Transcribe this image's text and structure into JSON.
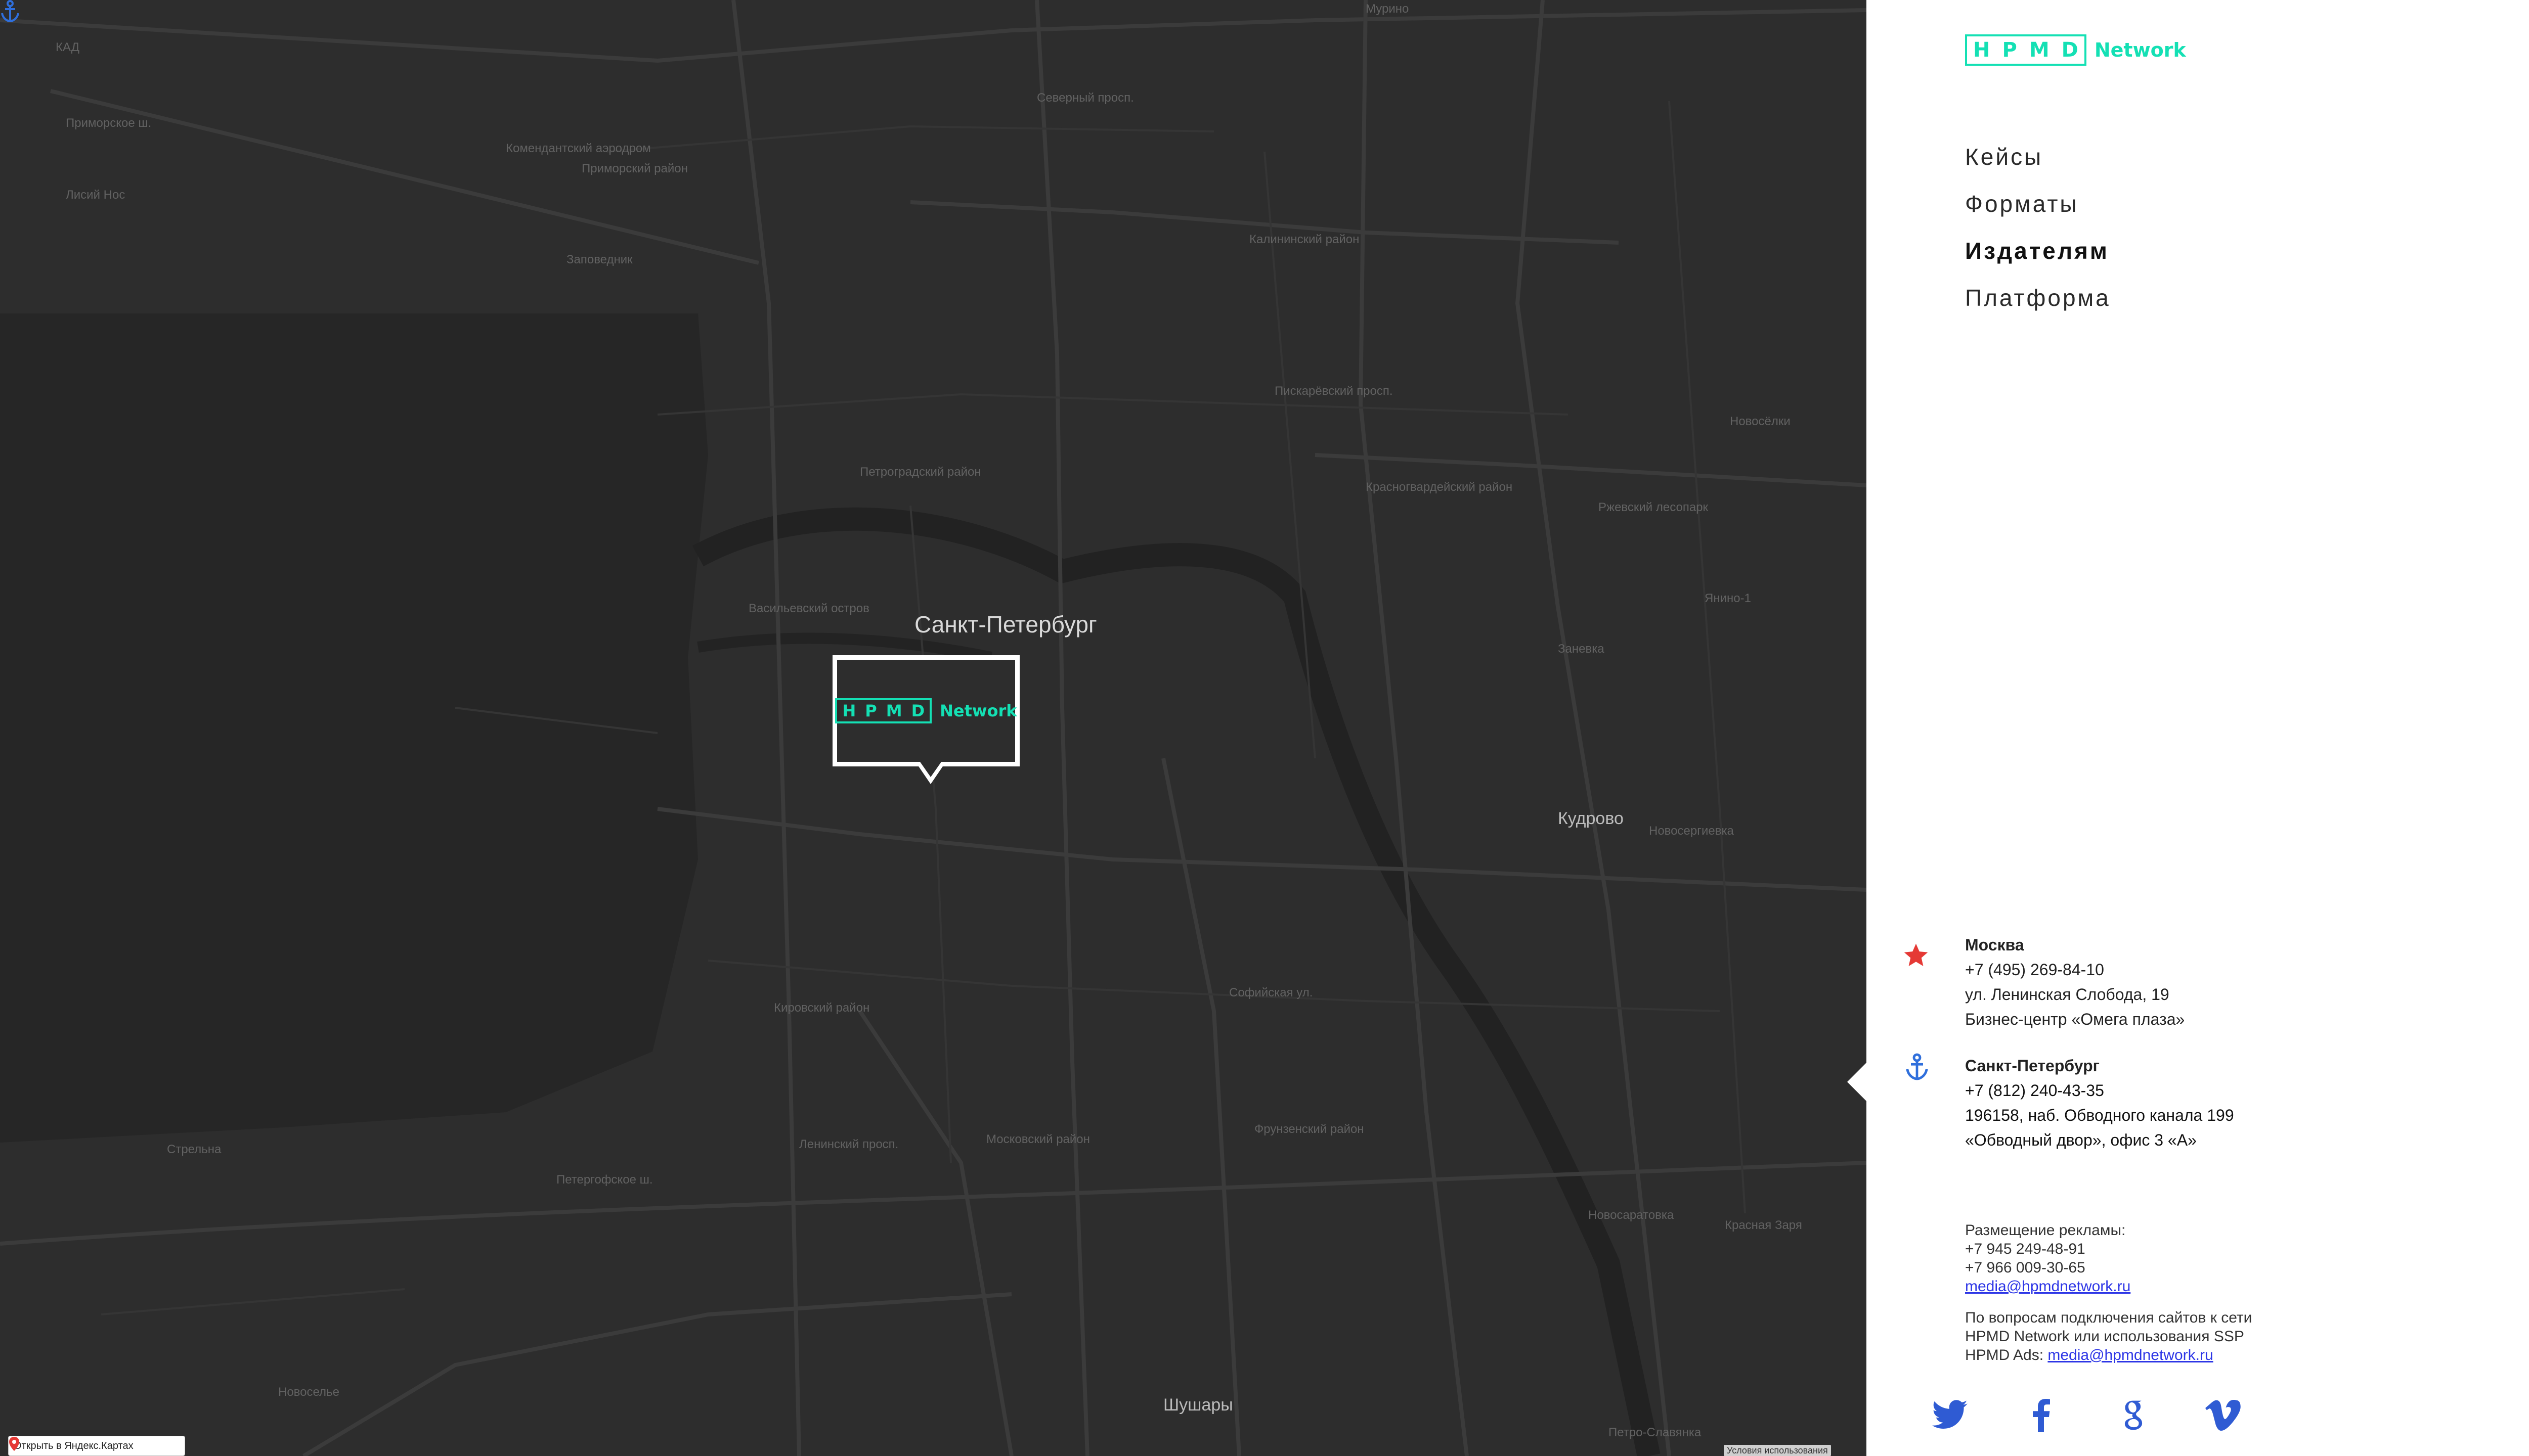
{
  "map": {
    "city_label": "Санкт-Петербург",
    "labels": [
      "Мурино",
      "КАД",
      "Приморское ш.",
      "Лисий Нос",
      "Приморский район",
      "Комендантский аэродром",
      "Заповедник",
      "Северный просп.",
      "Калининский район",
      "Кировский район",
      "Петроградский район",
      "Васильевский остров",
      "Красногвардейский район",
      "Кудрово",
      "Новосаратовка",
      "Новосергиевка",
      "Шушары",
      "Петро-Славянка",
      "Красная Заря",
      "Новоселье",
      "Стрельна",
      "Фрунзенский район",
      "Московский район",
      "Ленинский просп.",
      "Петергофское ш.",
      "Заневка",
      "Янино-1",
      "Новосёлки",
      "Ржевский лесопарк",
      "Софийская ул.",
      "Пискарёвский просп."
    ],
    "open_in_yandex": "Открыть в Яндекс.Картах",
    "terms": "Условия использования"
  },
  "bubble_logo": {
    "letters": [
      "H",
      "P",
      "M",
      "D"
    ],
    "word": "Network"
  },
  "sidebar": {
    "logo": {
      "letters": [
        "H",
        "P",
        "M",
        "D"
      ],
      "word": "Network"
    },
    "nav": [
      {
        "label": "Кейсы",
        "active": false
      },
      {
        "label": "Форматы",
        "active": false
      },
      {
        "label": "Издателям",
        "active": true
      },
      {
        "label": "Платформа",
        "active": false
      }
    ],
    "offices": [
      {
        "icon": "star-icon",
        "city": "Москва",
        "phone": "+7 (495) 269-84-10",
        "address": "ул. Ленинская Слобода, 19",
        "building": "Бизнес-центр «Омега плаза»"
      },
      {
        "icon": "anchor-icon",
        "city": "Санкт-Петербург",
        "phone": "+7 (812) 240-43-35",
        "address": "196158, наб. Обводного канала 199",
        "building": "«Обводный двор», офис 3 «А»"
      }
    ],
    "ads": {
      "title": "Размещение рекламы:",
      "phone1": "+7 945 249-48-91",
      "phone2": "+7 966 009-30-65",
      "email": "media@hpmdnetwork.ru"
    },
    "publishers": {
      "line1": "По вопросам подключения сайтов к сети",
      "line2": "HPMD Network или использования SSP",
      "line3_prefix": "HPMD Ads: ",
      "email": "media@hpmdnetwork.ru"
    },
    "social": [
      "twitter-icon",
      "facebook-icon",
      "google-icon",
      "vimeo-icon"
    ],
    "colors": {
      "accent": "#14e0b4",
      "link": "#2d36e6",
      "star": "#e53935",
      "anchor": "#2f6fdc"
    }
  }
}
